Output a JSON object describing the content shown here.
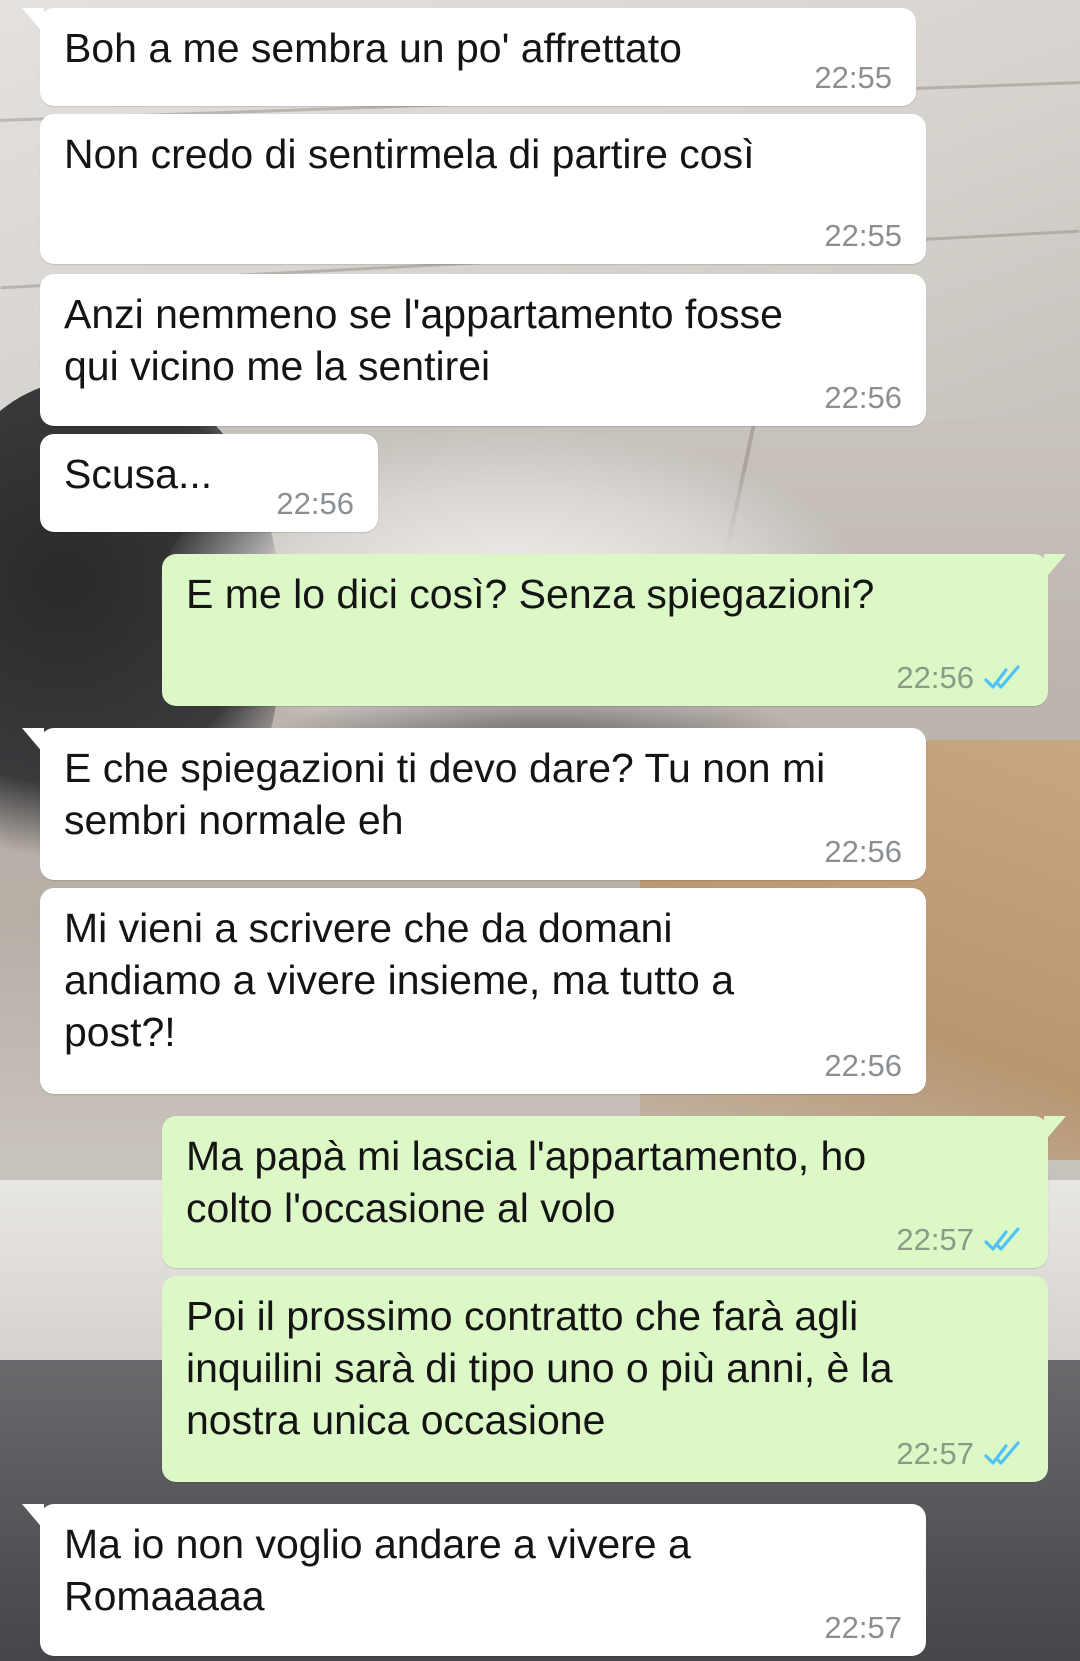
{
  "messages": [
    {
      "direction": "in",
      "text": "Boh a me sembra un po' affrettato",
      "time": "22:55"
    },
    {
      "direction": "in",
      "text": "Non credo di sentirmela di partire così",
      "time": "22:55"
    },
    {
      "direction": "in",
      "text": "Anzi nemmeno se l'appartamento fosse\nqui vicino me la sentirei",
      "time": "22:56"
    },
    {
      "direction": "in",
      "text": "Scusa...",
      "time": "22:56"
    },
    {
      "direction": "out",
      "text": "E me lo dici così? Senza spiegazioni?",
      "time": "22:56",
      "status": "read-double-check-icon"
    },
    {
      "direction": "in",
      "text": "E che spiegazioni ti devo dare? Tu non mi\nsembri normale eh",
      "time": "22:56"
    },
    {
      "direction": "in",
      "text": "Mi vieni a scrivere che da domani\nandiamo a vivere insieme, ma tutto a\npost?!",
      "time": "22:56"
    },
    {
      "direction": "out",
      "text": "Ma papà mi lascia l'appartamento, ho\ncolto l'occasione al volo",
      "time": "22:57",
      "status": "read-double-check-icon"
    },
    {
      "direction": "out",
      "text": "Poi il prossimo contratto che farà agli\ninquilini sarà di tipo uno o più anni, è la\nnostra unica occasione",
      "time": "22:57",
      "status": "read-double-check-icon"
    },
    {
      "direction": "in",
      "text": "Ma io non voglio andare a vivere a\nRomaaaaa",
      "time": "22:57"
    }
  ],
  "colors": {
    "incoming_bubble": "#ffffff",
    "outgoing_bubble": "#dcf8c6",
    "read_tick": "#4fc3f7",
    "timestamp": "#8a8f93"
  }
}
